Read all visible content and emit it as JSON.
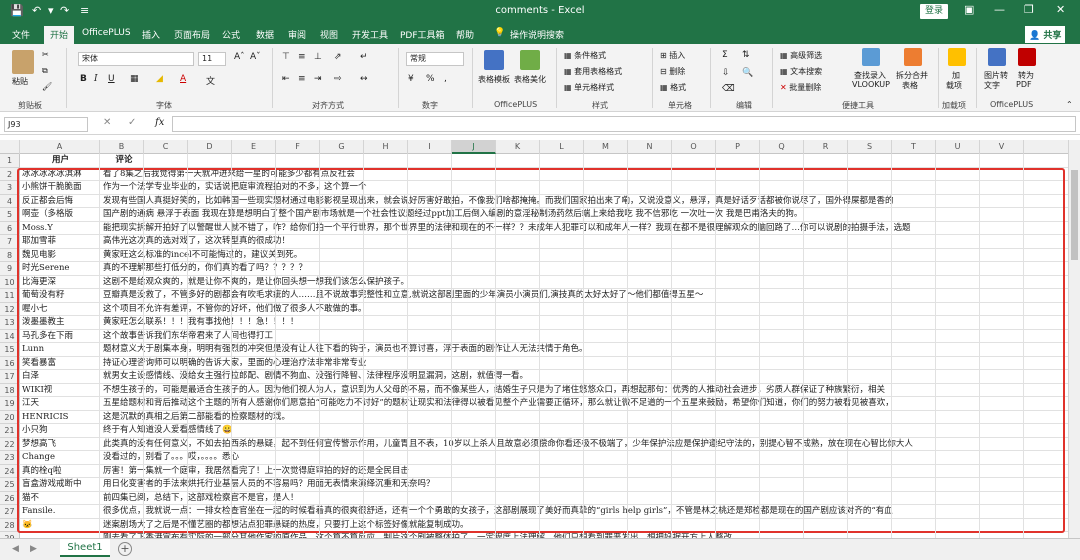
{
  "window": {
    "title": "comments  -  Excel",
    "login": "登录"
  },
  "ribbon_tabs": [
    "文件",
    "开始",
    "OfficePLUS",
    "插入",
    "页面布局",
    "公式",
    "数据",
    "审阅",
    "视图",
    "开发工具",
    "PDF工具箱",
    "帮助",
    "操作说明搜索"
  ],
  "share": "共享",
  "ribbon": {
    "paste": "粘贴",
    "clipboard": "剪贴板",
    "font_name": "宋体",
    "font_size": "11",
    "font_group": "字体",
    "align_group": "对齐方式",
    "number_format": "常规",
    "number_group": "数字",
    "table_template": "表格模板",
    "table_beautify": "表格美化",
    "officeplus_group": "OfficePLUS",
    "cond_format": "条件格式",
    "table_format": "套用表格格式",
    "cell_style": "单元格样式",
    "style_group": "样式",
    "insert": "插入",
    "delete": "删除",
    "format": "格式",
    "cells_group": "单元格",
    "edit_group": "编辑",
    "adv_filter": "高级筛选",
    "text_search": "文本搜索",
    "batch_delete": "批量删除",
    "find_vlookup_1": "查找录入",
    "find_vlookup_2": "VLOOKUP",
    "split_merge_1": "拆分合并",
    "split_merge_2": "表格",
    "convenient_group": "便捷工具",
    "add_item_1": "加",
    "add_item_2": "载项",
    "addins_group": "加载项",
    "img_to_text_1": "图片转",
    "img_to_text_2": "文字",
    "to_pdf_1": "转为",
    "to_pdf_2": "PDF",
    "officeplus2_group": "OfficePLUS"
  },
  "formula_bar": {
    "name_box": "J93",
    "fx": "fx",
    "value": ""
  },
  "columns": [
    "A",
    "B",
    "C",
    "D",
    "E",
    "F",
    "G",
    "H",
    "I",
    "J",
    "K",
    "L",
    "M",
    "N",
    "O",
    "P",
    "Q",
    "R",
    "S",
    "T",
    "U",
    "V"
  ],
  "selected_column": "J",
  "rows": [
    {
      "n": "1",
      "a": "用户",
      "b": "评论"
    },
    {
      "n": "2",
      "a": "冰冰冰冰冰淇淋",
      "b": "看了8集之后我觉得第一天就冲进来给一星的可能多少都有点反社会"
    },
    {
      "n": "3",
      "a": "小熊饼干脆脆面",
      "b": "作为一个法学专业毕业的，实话说把庭审流程拍对的不多，这个算一个"
    },
    {
      "n": "4",
      "a": "反正都会后悔",
      "b": "发现有些国人真挺好笑的，比如韩国一些现实题材通过电影影视呈现出来，就会说好厉害好敢拍，不像我们啥都掩掩。而我们国家拍出来了嘞，又说没意义，悬浮，真是好话歹话都被你说尽了，国外得屎都是香的"
    },
    {
      "n": "5",
      "a": "啊壶（多格版",
      "b": "国产剧的通病 悬浮于表面 我现在算是想明白了整个国产剧市场就是一个社会性议题经过ppt加工后倒入编剧的意淫秘制汤药然后端上来给我吃 我不信邪吃 一次吐一次 我是巴甫洛夫的狗。"
    },
    {
      "n": "6",
      "a": "Moss.Y",
      "b": "能把现实拆解开拍好了以警醒世人就不错了，咋？给你们拍一个平行世界，那个世界里的法律和现在的不一样？？未成年人犯罪可以和成年人一样？我现在都不是很理解观众的脑回路了…你可以说剧的拍摄手法，选题"
    },
    {
      "n": "7",
      "a": "耶加雪菲",
      "b": "高伟光这次真的选对戏了，这次转型真的很成功！"
    },
    {
      "n": "8",
      "a": "魏见电影",
      "b": "黄家旺这么标准的incel不可能悔过的，建议关到死。"
    },
    {
      "n": "9",
      "a": "时光Serene",
      "b": "真的不理解那些打低分的，你们真的看了吗？？？？？"
    },
    {
      "n": "10",
      "a": "比海更深",
      "b": "这剧不是给观众爽的，就是让你不爽的，是让你回头想一想我们该怎么保护孩子。"
    },
    {
      "n": "11",
      "a": "葡萄没有籽",
      "b": "豆瓣真是没救了，不管多好的剧都会有吹毛求疵的人……且不说故事完整性和立意,就说这部剧里面的少年演员小演员们,演技真的太好太好了～他们都值得五星～"
    },
    {
      "n": "12",
      "a": "喔小七",
      "b": "这个项目不允许有差评，不管你的好坏，他们做了很多人不敢做的事。"
    },
    {
      "n": "13",
      "a": "泼墨墨教主",
      "b": "黄家旺怎么联系！！！我有事找他！！！急！！！！"
    },
    {
      "n": "14",
      "a": "马孔多在下雨",
      "b": "这个故事告诉我们东华帝君来了人间也得打工"
    },
    {
      "n": "15",
      "a": "Lunn",
      "b": "题材意义大于剧集本身，明明有强烈的冲突但是没有让人往下看的钩子，演员也不算讨喜，浮于表面的剧作让人无法共情于角色。"
    },
    {
      "n": "16",
      "a": "笑看暴富",
      "b": "持证心理咨询师可以明确的告诉大家，里面的心理治疗法非常非常专业"
    },
    {
      "n": "17",
      "a": "白泽",
      "b": "就男女主设感情线、没给女主强行拉郎配、剧情不狗血、没强行降智、法律程序没明显漏洞，这剧，就值得一看。"
    },
    {
      "n": "18",
      "a": "WIKI视",
      "b": "不想生孩子的，可能是最适合生孩子的人。因为他们视人为人，意识到为人父母的不易，而不像某些人，结婚生子只是为了堵住悠悠众口，再想起那句：优秀的人推动社会进步，劣质人群保证了种族繁衍，相关"
    },
    {
      "n": "19",
      "a": "江天",
      "b": "五星给题材和背后推动这个主题的所有人感谢你们愿意拍“可能吃力不讨好”的题材让现实和法律得以被看见整个产业需要正循环，那么就让微不足道的一个五星来鼓励，希望你们知道，你们的努力被看见被喜欢，"
    },
    {
      "n": "20",
      "a": "HENRICIS",
      "b": "这是沉默的真相之后第二部能看的检察题材的戏。"
    },
    {
      "n": "21",
      "a": "小只狗",
      "b": "终于有人知道没人爱看感情线了😀"
    },
    {
      "n": "22",
      "a": "梦想高飞",
      "b": "此类真的没有任何意义，不如去拍西杀的悬疑，起不到任何宣传警示作用，儿童胃且不表，10岁以上杀人且故意必须偿命你看还极不极端了，少年保护法应是保护遵纪守法的，别提心智不成熟，放在现在心智比你大人"
    },
    {
      "n": "23",
      "a": "Change",
      "b": "没看过的，别看了。。。哎，。。。。悉心"
    },
    {
      "n": "24",
      "a": "真的栓q啦",
      "b": "厉害！第一集就一个庭审，我居然看完了！上一次觉得庭审拍的好的还是全民目击"
    },
    {
      "n": "25",
      "a": "盲盒游戏戒断中",
      "b": "用日化变害者的手法来烘托行业基层人员的不容易吗？用面无表情来演绎沉重和无奈吗？"
    },
    {
      "n": "26",
      "a": "猫不",
      "b": "前四集已阅，总结下，这部戏检察官不是官，是人！"
    },
    {
      "n": "27",
      "a": "Fansile.",
      "b": "很多优点，我就说一点：一排女检查官坐在一起的时候看着真的很爽很舒适，还有一个个勇敢的女孩子，这部剧展现了美好而真挚的“girls help girls”，不管是林之桃还是郑检都是现在的国产剧应该对齐的“有血"
    },
    {
      "n": "28",
      "a": "🐱",
      "b": "迷案剧场大了之后是不懂艺圈的都想沾点犯罪悬疑的热度，只要打上这个标签好像就能复制成功。"
    },
    {
      "n": "29",
      "a": "",
      "b": "刚去看了下香港宣布有实际的一部分其他作家的原作品，这个算不算反应，制片这个剧被整体拍了，一定程度上法理解，他们只想看到罪恶发出，想把好据开方上人整改。"
    }
  ],
  "sheet_tab": "Sheet1",
  "colors": {
    "excel_green": "#217346",
    "highlight_red": "#e0322b"
  }
}
